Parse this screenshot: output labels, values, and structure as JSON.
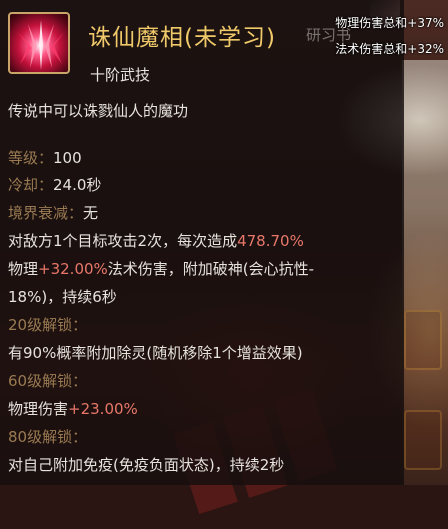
{
  "skill": {
    "name": "诛仙魔相(未学习)",
    "faint_tab": "研习书",
    "tier": "十阶武技",
    "description": "传说中可以诛戮仙人的魔功"
  },
  "bonuses": [
    {
      "label": "物理伤害总和",
      "value": "+37%"
    },
    {
      "label": "法术伤害总和",
      "value": "+32%"
    }
  ],
  "stats": {
    "level_label": "等级：",
    "level": "100",
    "cooldown_label": "冷却：",
    "cooldown": "24.0秒",
    "decay_label": "境界衰减：",
    "decay": "无"
  },
  "effect": {
    "l1_pre": "对敌方1个目标攻击2次，每次造成",
    "l1_pct": "478.70%",
    "l2_pre": "物理",
    "l2_pct": "+32.00%",
    "l2_post": "法术伤害，附加破神(会心抗性-",
    "l3": "18%)，持续6秒"
  },
  "unlocks": [
    {
      "title": "20级解锁：",
      "text_pre": "有90%概率附加除灵(随机移除1个增益效果)",
      "text_pct": "",
      "text_post": ""
    },
    {
      "title": "60级解锁：",
      "text_pre": "物理伤害",
      "text_pct": "+23.00%",
      "text_post": ""
    },
    {
      "title": "80级解锁：",
      "text_pre": "对自己附加免疫(免疫负面状态)，持续2秒",
      "text_pct": "",
      "text_post": ""
    }
  ],
  "colors": {
    "title": "#f0c96a",
    "highlight": "#e8776a",
    "unlock": "#9a7a52",
    "text": "#e6e2dc"
  }
}
